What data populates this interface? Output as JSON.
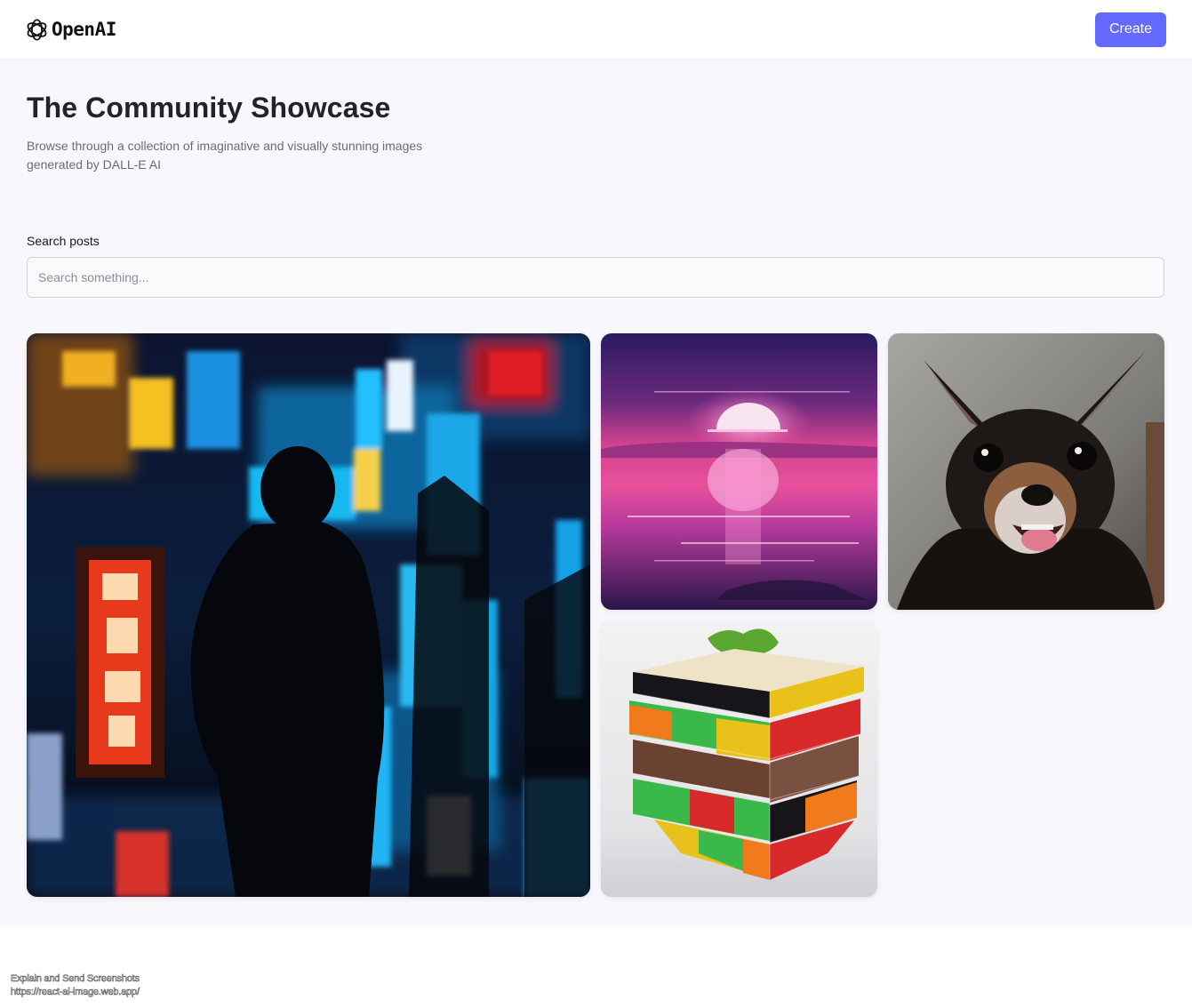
{
  "header": {
    "logo_text": "OpenAI",
    "logo_icon": "openai-logo-icon",
    "create_label": "Create"
  },
  "hero": {
    "title": "The Community Showcase",
    "subtitle": "Browse through a collection of imaginative and visually stunning images generated by DALL-E AI"
  },
  "search": {
    "label": "Search posts",
    "placeholder": "Search something...",
    "value": ""
  },
  "gallery": {
    "items": [
      {
        "subject": "silhouette in neon-lit city street at night"
      },
      {
        "subject": "pink and purple sunset over water"
      },
      {
        "subject": "chihuahua puppy smiling"
      },
      {
        "subject": "rubik's cube sandwich"
      }
    ]
  },
  "overlay": {
    "line1": "Explain and Send Screenshots",
    "line2": "https://react-ai-image.web.app/"
  },
  "colors": {
    "accent": "#6469ff",
    "background": "#f8f8fc",
    "title": "#222328",
    "subtitle": "#666e75"
  }
}
